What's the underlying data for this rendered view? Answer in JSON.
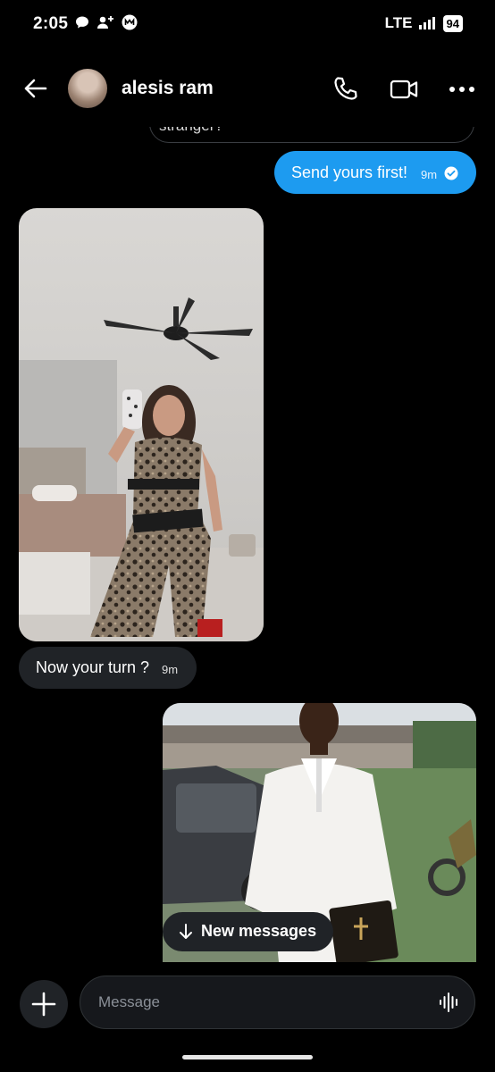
{
  "status_bar": {
    "time": "2:05",
    "network": "LTE",
    "battery": "94",
    "icons": [
      "chat-bubble-icon",
      "add-person-icon",
      "moments-icon",
      "signal-icon"
    ]
  },
  "header": {
    "contact_name": "alesis ram",
    "icons": [
      "back-arrow-icon",
      "phone-icon",
      "video-icon",
      "more-icon"
    ]
  },
  "messages": [
    {
      "type": "text",
      "direction": "received",
      "text": "stranger?"
    },
    {
      "type": "text",
      "direction": "sent",
      "text": "Send yours first!",
      "time": "9m",
      "status": "read"
    },
    {
      "type": "image",
      "direction": "received",
      "description_icon": "photo-selfie"
    },
    {
      "type": "text",
      "direction": "received",
      "text": "Now your turn ?",
      "time": "9m"
    },
    {
      "type": "image",
      "direction": "sent",
      "description_icon": "photo-portrait"
    }
  ],
  "new_messages_pill": {
    "label": "New messages"
  },
  "composer": {
    "placeholder": "Message",
    "value": ""
  },
  "colors": {
    "background": "#000000",
    "sent_bubble": "#1d9bf0",
    "received_bubble": "#202327",
    "input_bg": "#16181c"
  }
}
